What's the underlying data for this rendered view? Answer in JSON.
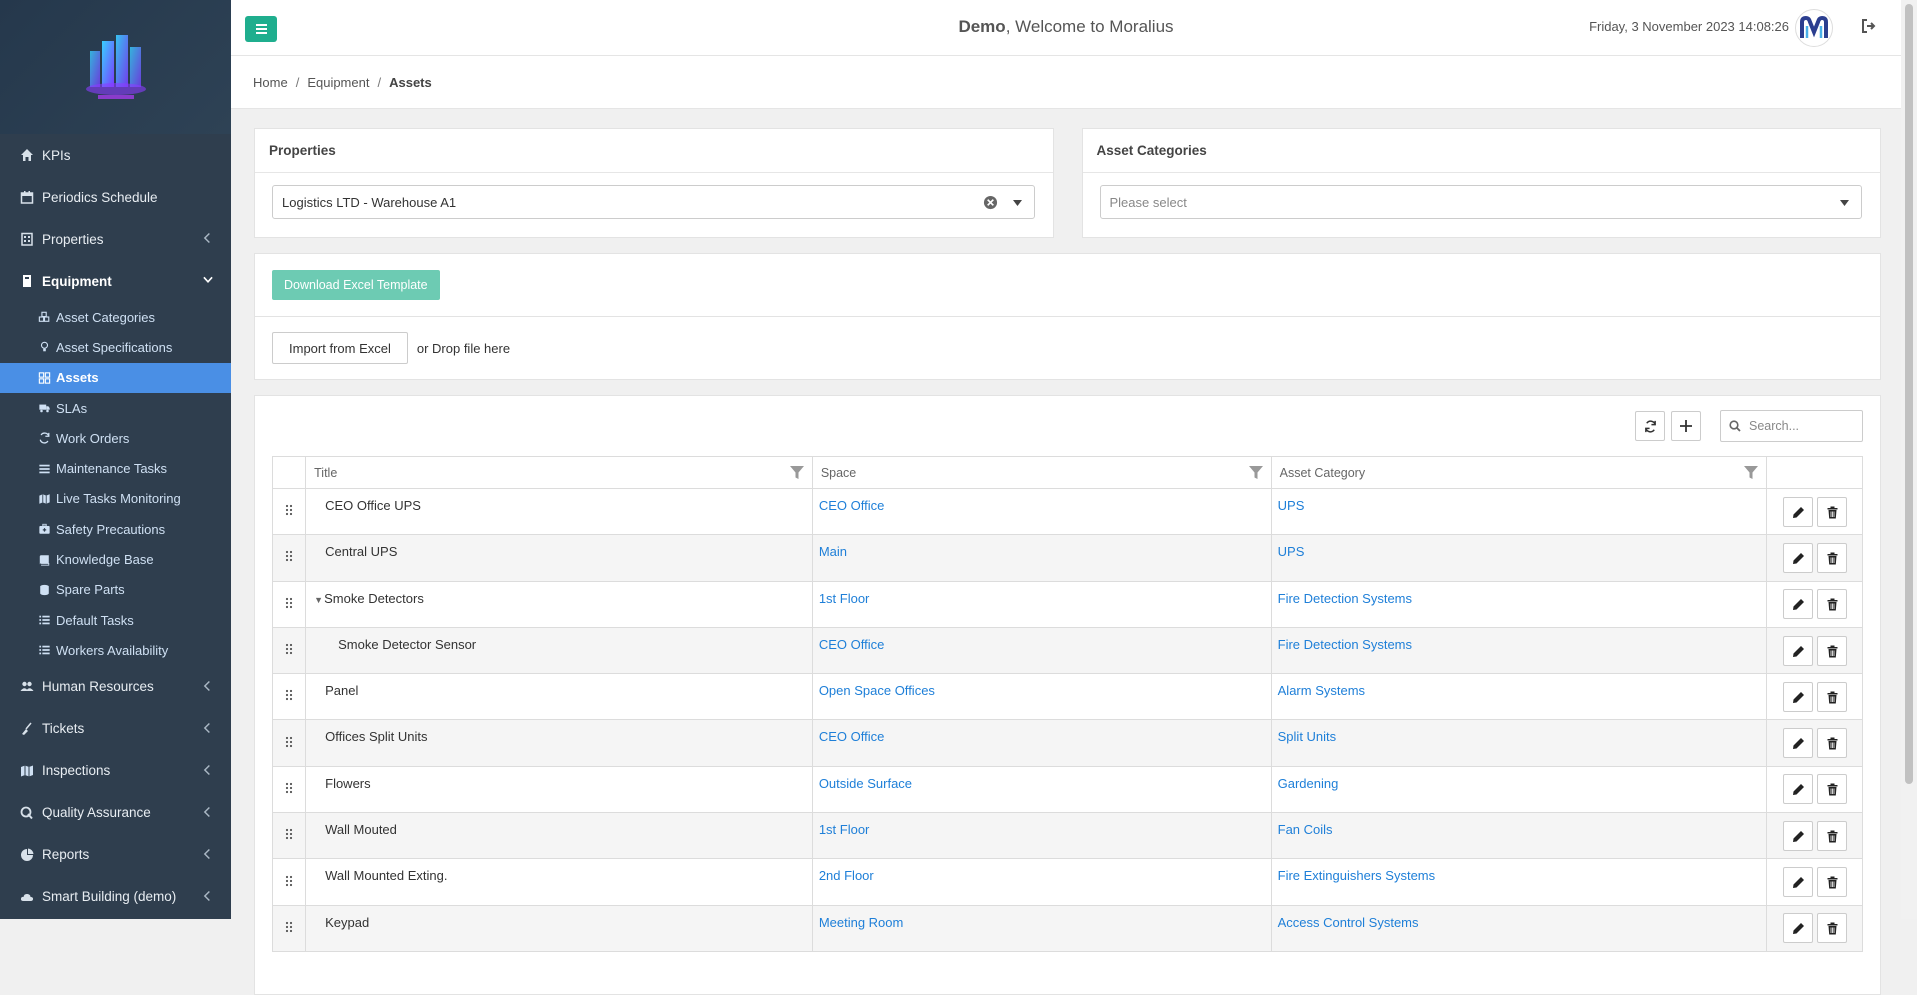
{
  "header": {
    "user": "Demo",
    "welcome_text": ", Welcome to Moralius",
    "datetime": "Friday, 3 November 2023 14:08:26"
  },
  "sidebar": {
    "items": [
      {
        "label": "KPIs",
        "icon": "home-icon",
        "has_children": false
      },
      {
        "label": "Periodics Schedule",
        "icon": "calendar-icon",
        "has_children": false
      },
      {
        "label": "Properties",
        "icon": "building-icon",
        "has_children": true
      },
      {
        "label": "Equipment",
        "icon": "equipment-icon",
        "has_children": true,
        "open": true
      }
    ],
    "equipment_children": [
      {
        "label": "Asset Categories",
        "icon": "cubes-icon"
      },
      {
        "label": "Asset Specifications",
        "icon": "lightbulb-icon"
      },
      {
        "label": "Assets",
        "icon": "grid-icon",
        "active": true
      },
      {
        "label": "SLAs",
        "icon": "truck-icon"
      },
      {
        "label": "Work Orders",
        "icon": "refresh-icon"
      },
      {
        "label": "Maintenance Tasks",
        "icon": "list-icon"
      },
      {
        "label": "Live Tasks Monitoring",
        "icon": "map-icon"
      },
      {
        "label": "Safety Precautions",
        "icon": "medkit-icon"
      },
      {
        "label": "Knowledge Base",
        "icon": "book-icon"
      },
      {
        "label": "Spare Parts",
        "icon": "database-icon"
      },
      {
        "label": "Default Tasks",
        "icon": "list-ul-icon"
      },
      {
        "label": "Workers Availability",
        "icon": "list-ul-icon"
      }
    ],
    "bottom_items": [
      {
        "label": "Human Resources",
        "icon": "users-icon"
      },
      {
        "label": "Tickets",
        "icon": "broom-icon"
      },
      {
        "label": "Inspections",
        "icon": "map-icon"
      },
      {
        "label": "Quality Assurance",
        "icon": "qa-icon"
      },
      {
        "label": "Reports",
        "icon": "pie-chart-icon"
      },
      {
        "label": "Smart Building (demo)",
        "icon": "cloud-icon"
      }
    ]
  },
  "breadcrumb": {
    "home": "Home",
    "equipment": "Equipment",
    "current": "Assets"
  },
  "filters": {
    "properties_title": "Properties",
    "properties_value": "Logistics LTD - Warehouse A1",
    "categories_title": "Asset Categories",
    "categories_placeholder": "Please select"
  },
  "actions": {
    "download_label": "Download Excel Template",
    "import_label": "Import from Excel",
    "drop_text": "or Drop file here"
  },
  "grid": {
    "search_placeholder": "Search...",
    "columns": {
      "title": "Title",
      "space": "Space",
      "category": "Asset Category"
    },
    "rows": [
      {
        "title": "CEO Office UPS",
        "space": "CEO Office",
        "category": "UPS",
        "level": 0
      },
      {
        "title": "Central UPS",
        "space": "Main",
        "category": "UPS",
        "level": 0
      },
      {
        "title": "Smoke Detectors",
        "space": "1st Floor",
        "category": "Fire Detection Systems",
        "level": 0,
        "expanded": true
      },
      {
        "title": "Smoke Detector Sensor",
        "space": "CEO Office",
        "category": "Fire Detection Systems",
        "level": 1
      },
      {
        "title": "Panel",
        "space": "Open Space Offices",
        "category": "Alarm Systems",
        "level": 0
      },
      {
        "title": "Offices Split Units",
        "space": "CEO Office",
        "category": "Split Units",
        "level": 0
      },
      {
        "title": "Flowers",
        "space": "Outside Surface",
        "category": "Gardening",
        "level": 0
      },
      {
        "title": "Wall Mouted",
        "space": "1st Floor",
        "category": "Fan Coils",
        "level": 0
      },
      {
        "title": "Wall Mounted Exting.",
        "space": "2nd Floor",
        "category": "Fire Extinguishers Systems",
        "level": 0
      },
      {
        "title": "Keypad",
        "space": "Meeting Room",
        "category": "Access Control Systems",
        "level": 0
      }
    ]
  },
  "colors": {
    "accent": "#4a8fe5",
    "sidebar": "#2f3e4e",
    "green": "#1fae8e",
    "link": "#1e7fd8"
  }
}
